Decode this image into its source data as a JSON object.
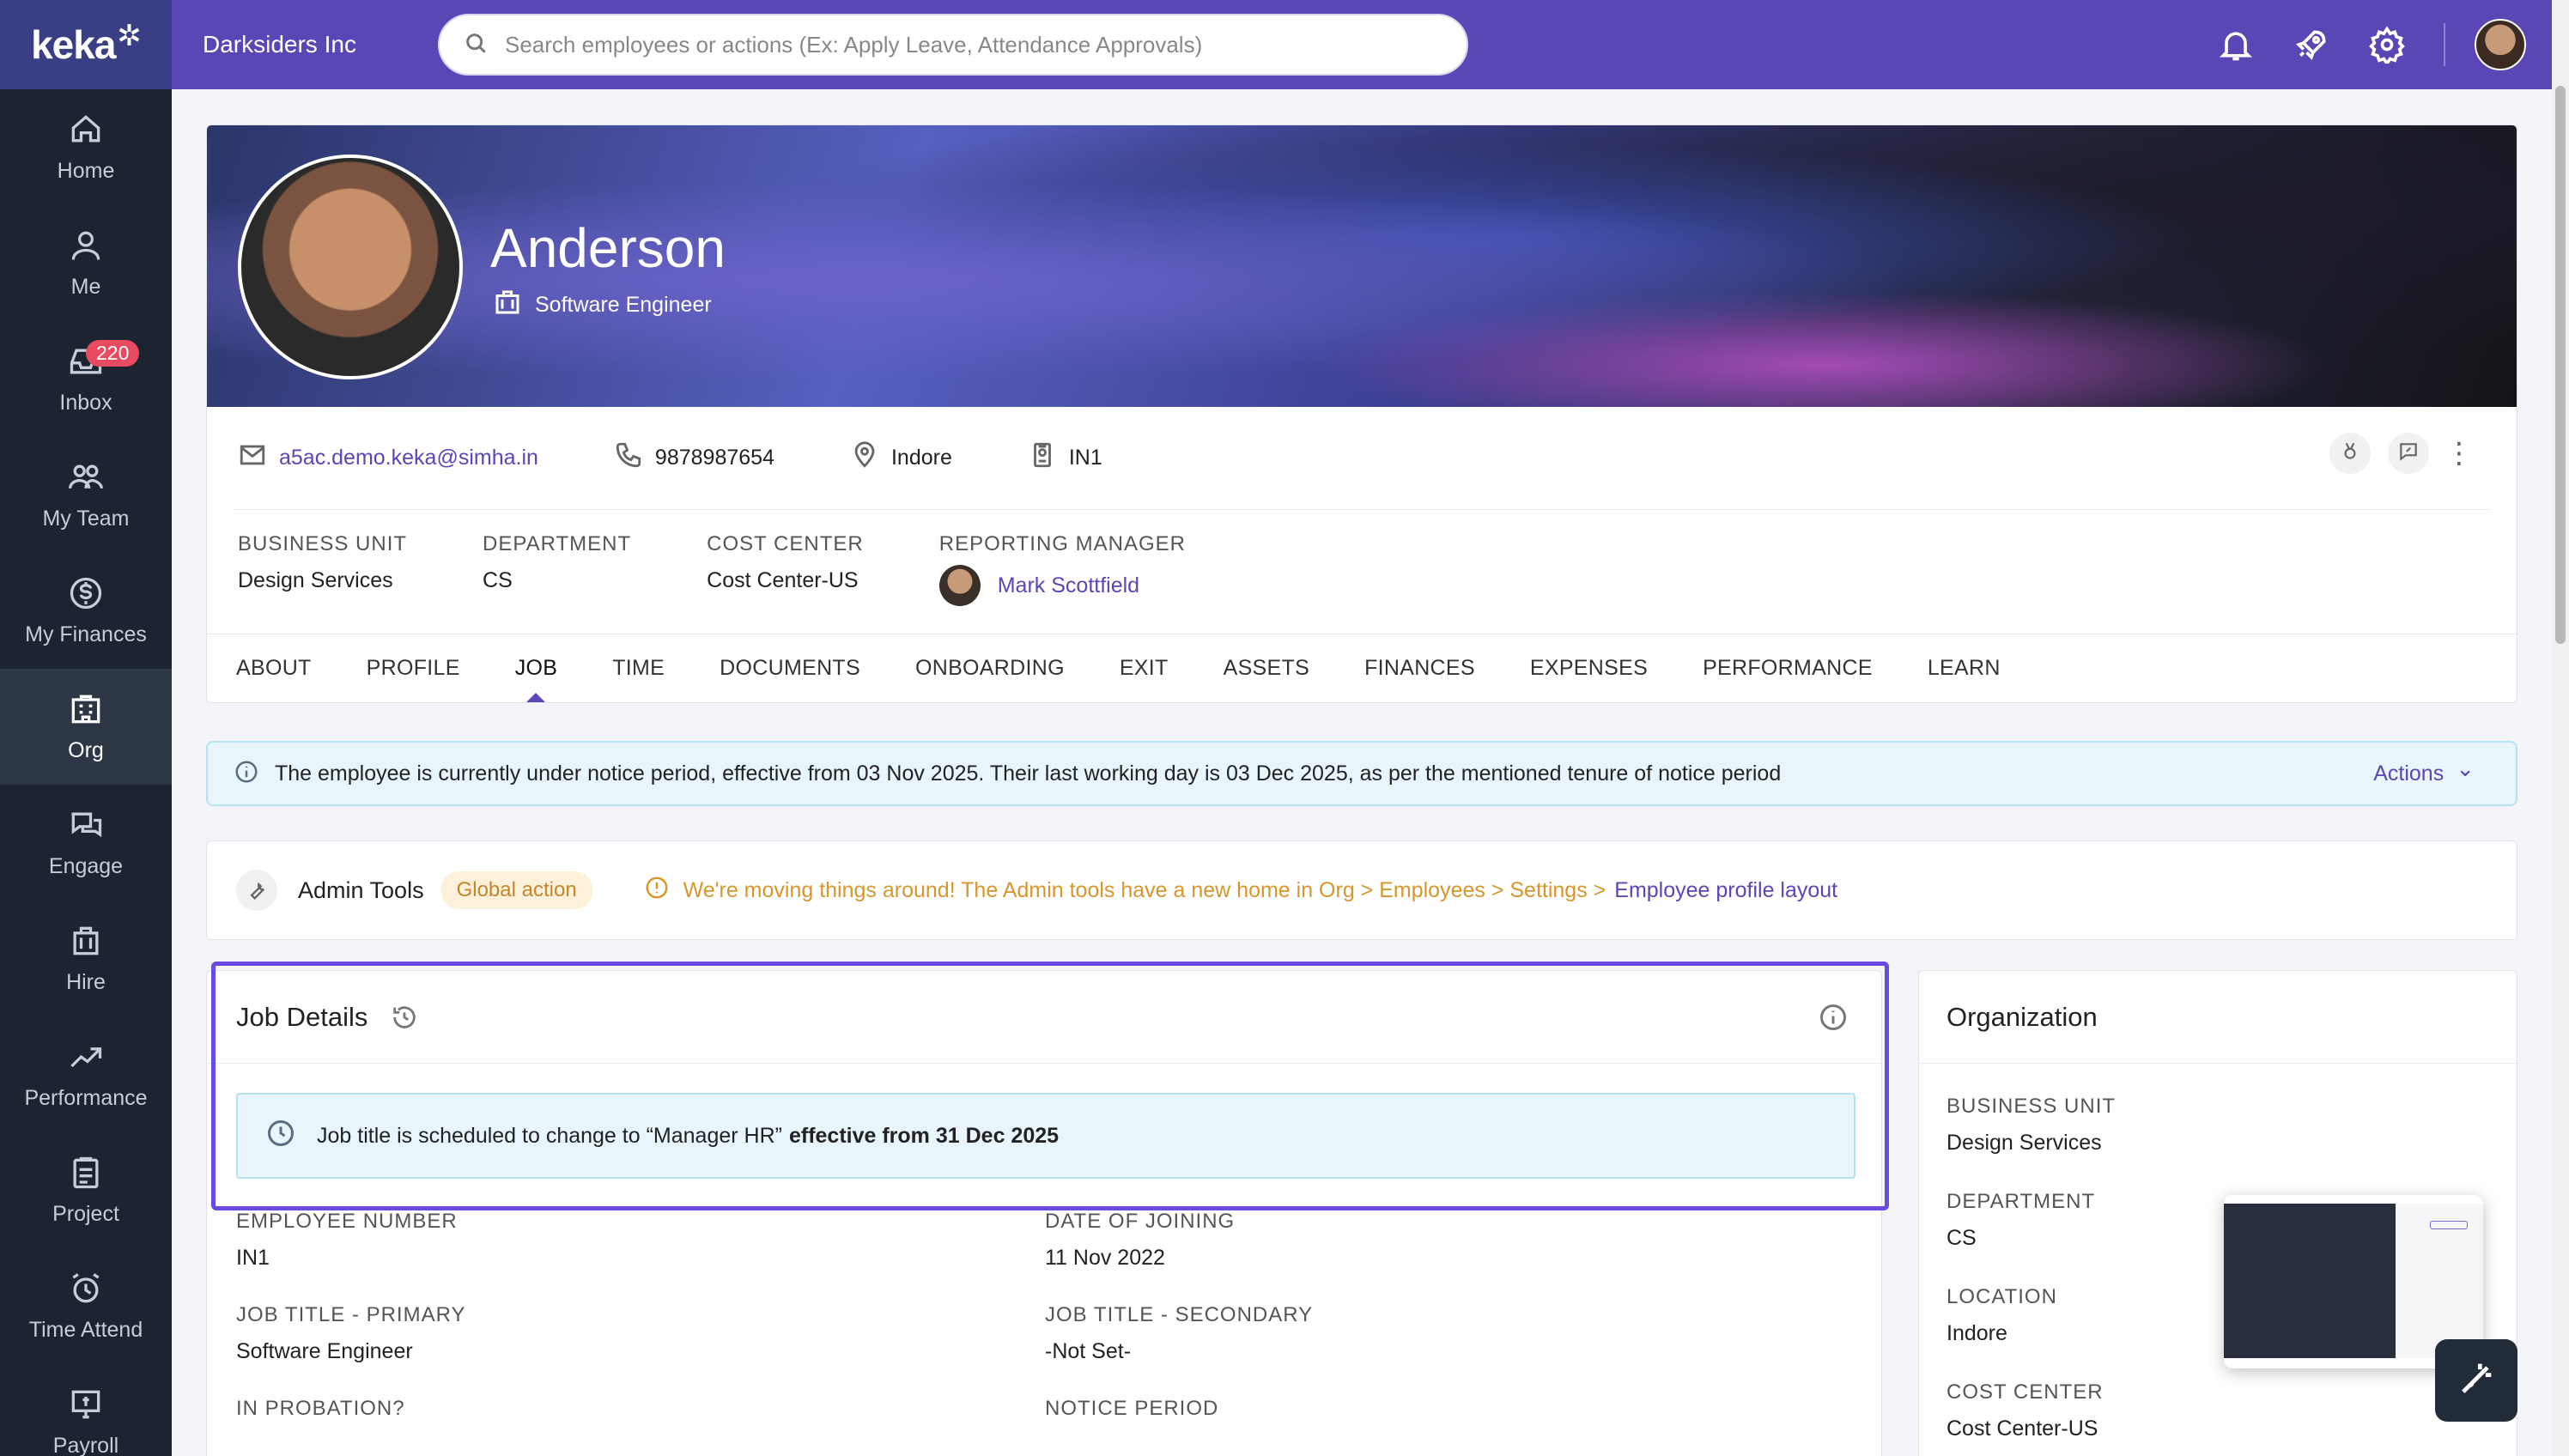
{
  "sidebar": {
    "logo": "keka",
    "items": [
      {
        "label": "Home",
        "icon": "home-icon"
      },
      {
        "label": "Me",
        "icon": "user-icon"
      },
      {
        "label": "Inbox",
        "icon": "inbox-icon",
        "badge": "220"
      },
      {
        "label": "My Team",
        "icon": "team-icon"
      },
      {
        "label": "My Finances",
        "icon": "dollar-icon"
      },
      {
        "label": "Org",
        "icon": "building-icon",
        "active": true
      },
      {
        "label": "Engage",
        "icon": "chat-icon"
      },
      {
        "label": "Hire",
        "icon": "briefcase-icon"
      },
      {
        "label": "Performance",
        "icon": "trend-icon"
      },
      {
        "label": "Project",
        "icon": "clipboard-icon"
      },
      {
        "label": "Time Attend",
        "icon": "alarm-icon"
      },
      {
        "label": "Payroll",
        "icon": "payroll-icon"
      }
    ]
  },
  "topbar": {
    "org_name": "Darksiders Inc",
    "search_placeholder": "Search employees or actions (Ex: Apply Leave, Attendance Approvals)",
    "icons": [
      "bell-icon",
      "rocket-icon",
      "gear-icon",
      "avatar"
    ]
  },
  "profile": {
    "name": "Anderson",
    "title": "Software Engineer",
    "email": "a5ac.demo.keka@simha.in",
    "phone": "9878987654",
    "location": "Indore",
    "employee_code": "IN1",
    "business_unit_label": "BUSINESS UNIT",
    "business_unit": "Design Services",
    "department_label": "DEPARTMENT",
    "department": "CS",
    "cost_center_label": "COST CENTER",
    "cost_center": "Cost Center-US",
    "reporting_manager_label": "REPORTING MANAGER",
    "reporting_manager": "Mark Scottfield"
  },
  "tabs": [
    "ABOUT",
    "PROFILE",
    "JOB",
    "TIME",
    "DOCUMENTS",
    "ONBOARDING",
    "EXIT",
    "ASSETS",
    "FINANCES",
    "EXPENSES",
    "PERFORMANCE",
    "LEARN"
  ],
  "active_tab": "JOB",
  "notice": {
    "text": "The employee is currently under notice period, effective from 03 Nov 2025. Their last working day is 03 Dec 2025, as per the mentioned tenure of notice period",
    "actions_label": "Actions"
  },
  "admin_tools": {
    "title": "Admin Tools",
    "tag": "Global action",
    "message": "We're moving things around! The Admin tools have a new home in Org > Employees > Settings >",
    "link": "Employee profile layout"
  },
  "job_details": {
    "title": "Job Details",
    "schedule_prefix": "Job title is scheduled to change to “Manager HR”",
    "schedule_bold": "effective from 31 Dec 2025",
    "fields": [
      {
        "label": "EMPLOYEE NUMBER",
        "value": "IN1"
      },
      {
        "label": "DATE OF JOINING",
        "value": "11 Nov 2022"
      },
      {
        "label": "JOB TITLE - PRIMARY",
        "value": "Software Engineer"
      },
      {
        "label": "JOB TITLE - SECONDARY",
        "value": "-Not Set-"
      },
      {
        "label": "IN PROBATION?",
        "value": ""
      },
      {
        "label": "NOTICE PERIOD",
        "value": ""
      }
    ]
  },
  "organization": {
    "title": "Organization",
    "fields": [
      {
        "label": "BUSINESS UNIT",
        "value": "Design Services"
      },
      {
        "label": "DEPARTMENT",
        "value": "CS"
      },
      {
        "label": "LOCATION",
        "value": "Indore"
      },
      {
        "label": "COST CENTER",
        "value": "Cost Center-US"
      }
    ]
  },
  "colors": {
    "brand": "#5b46b5",
    "sidebar": "#1b2430",
    "highlight": "#6a4be0",
    "notice_bg": "#e8f6fc",
    "warning": "#d8962c"
  }
}
